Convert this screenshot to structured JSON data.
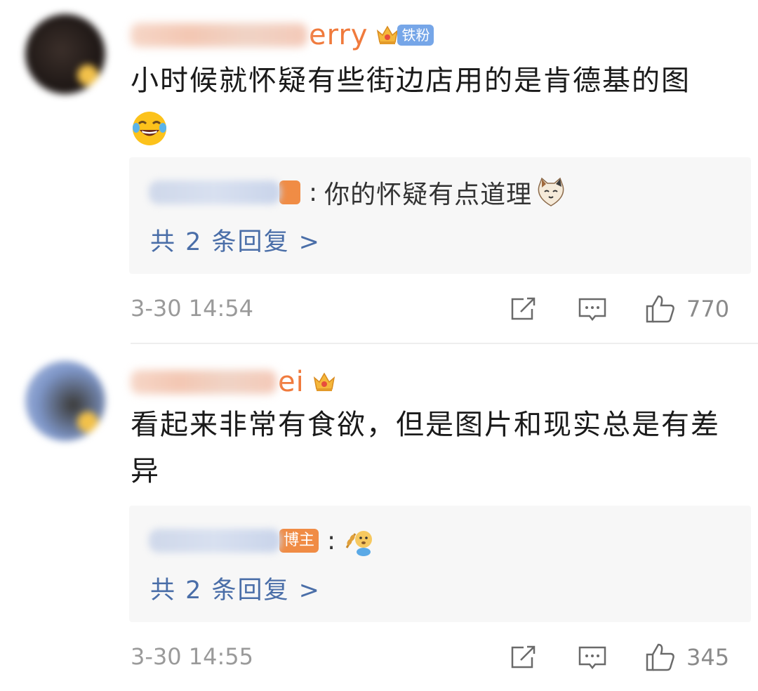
{
  "comments": [
    {
      "username_visible": "erry",
      "fan_badge": "铁粉",
      "text": "小时候就怀疑有些街边店用的是肯德基的图",
      "text_emoji": "laughing-tears-emoji",
      "reply": {
        "text": "你的怀疑有点道理",
        "emoji": "cat-face-emoji",
        "more": "共 2 条回复 >"
      },
      "time": "3-30 14:54",
      "likes": "770"
    },
    {
      "username_visible": "ei",
      "text": "看起来非常有食欲，但是图片和现实总是有差异",
      "reply": {
        "host_tag": "博主",
        "emoji": "dog-wheat-emoji",
        "more": "共 2 条回复 >"
      },
      "time": "3-30 14:55",
      "likes": "345"
    }
  ],
  "colors": {
    "username": "#f07a3c",
    "link": "#4a6ea8",
    "fan_badge_bg": "#76a6e8",
    "host_tag_bg": "#f08c45",
    "reply_box_bg": "#f7f7f7",
    "meta": "#9a9a9a"
  },
  "icons": [
    "share-icon",
    "comment-icon",
    "like-icon",
    "crown-icon"
  ]
}
